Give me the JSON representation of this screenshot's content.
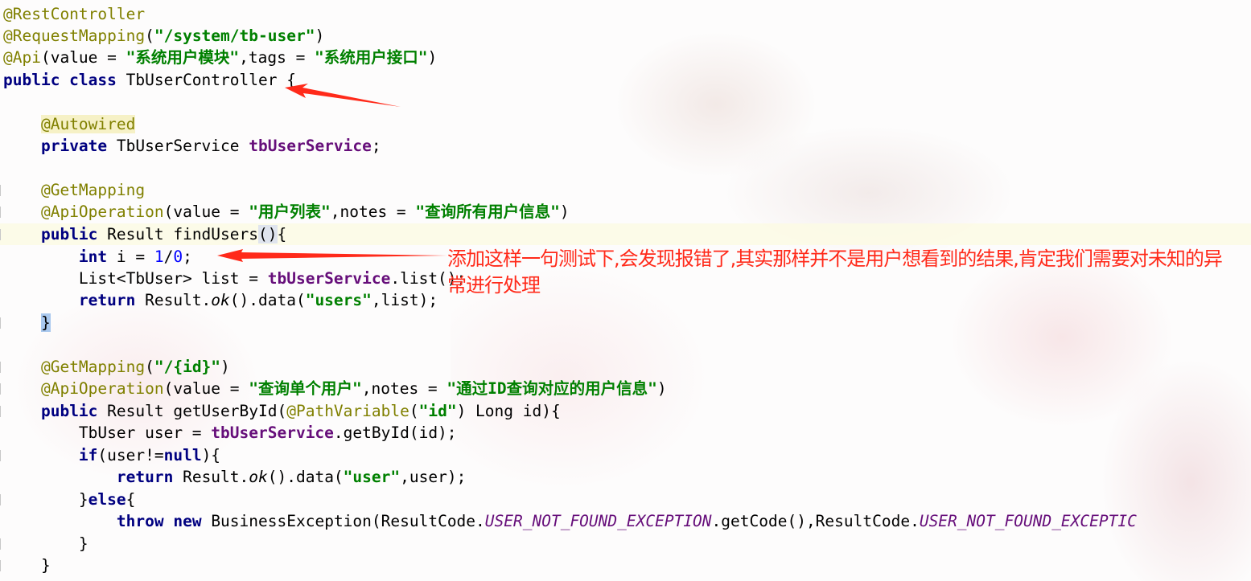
{
  "code": {
    "l1": {
      "annotation": "@RestController"
    },
    "l2": {
      "annotation": "@RequestMapping",
      "p1": "(",
      "str": "\"/system/tb-user\"",
      "p2": ")"
    },
    "l3": {
      "annotation": "@Api",
      "p1": "(value = ",
      "str1": "\"系统用户模块\"",
      "p2": ",tags = ",
      "str2": "\"系统用户接口\"",
      "p3": ")"
    },
    "l4": {
      "kw": "public class",
      "rest": " TbUserController {"
    },
    "l5": {
      "annotation": "@Autowired"
    },
    "l6": {
      "kw": "private",
      "type": " TbUserService ",
      "field": "tbUserService",
      "end": ";"
    },
    "l7": {
      "annotation": "@GetMapping"
    },
    "l8": {
      "annotation": "@ApiOperation",
      "p1": "(value = ",
      "str1": "\"用户列表\"",
      "p2": ",notes = ",
      "str2": "\"查询所有用户信息\"",
      "p3": ")"
    },
    "l9": {
      "kw": "public",
      "rest": " Result findUsers",
      "parens": "()",
      "brace": "{"
    },
    "l10": {
      "kw": "int",
      "var": " i = ",
      "num1": "1",
      "slash": "/",
      "num2": "0",
      "end": ";"
    },
    "l11": {
      "pre": "List<TbUser> list = ",
      "field": "tbUserService",
      "post": ".list();"
    },
    "l12": {
      "kw": "return",
      "pre": " Result.",
      "method": "ok",
      "mid": "().data(",
      "str": "\"users\"",
      "post": ",list);"
    },
    "l13": {
      "brace": "}"
    },
    "l14": {
      "annotation": "@GetMapping",
      "p1": "(",
      "str": "\"/{id}\"",
      "p2": ")"
    },
    "l15": {
      "annotation": "@ApiOperation",
      "p1": "(value = ",
      "str1": "\"查询单个用户\"",
      "p2": ",notes = ",
      "str2": "\"通过ID查询对应的用户信息\"",
      "p3": ")"
    },
    "l16": {
      "kw": "public",
      "pre": " Result getUserById(",
      "annotation": "@PathVariable",
      "p1": "(",
      "str": "\"id\"",
      "post": ") Long id){"
    },
    "l17": {
      "pre": "TbUser user = ",
      "field": "tbUserService",
      "post": ".getById(id);"
    },
    "l18": {
      "kw1": "if",
      "mid": "(user!=",
      "kw2": "null",
      "post": "){"
    },
    "l19": {
      "kw": "return",
      "pre": " Result.",
      "method": "ok",
      "mid": "().data(",
      "str": "\"user\"",
      "post": ",user);"
    },
    "l20": {
      "pre": "}",
      "kw": "else",
      "post": "{"
    },
    "l21": {
      "kw1": "throw",
      "kw2": "new",
      "pre": " BusinessException(ResultCode.",
      "const1": "USER_NOT_FOUND_EXCEPTION",
      "mid": ".getCode(),ResultCode.",
      "const2": "USER_NOT_FOUND_EXCEPTIC"
    },
    "l22": {
      "brace": "}"
    },
    "l23": {
      "brace": "}"
    }
  },
  "annotation_note": {
    "text": "添加这样一句测试下,会发现报错了,其实那样并不是用户想看到的结果,肯定我们需要对未知的异常进行处理",
    "color": "#ff2a1a"
  },
  "colors": {
    "keyword": "#000080",
    "string": "#008000",
    "annotation": "#808000",
    "field": "#660e7a",
    "number": "#0000ff",
    "arrow": "#ff2a1a"
  }
}
